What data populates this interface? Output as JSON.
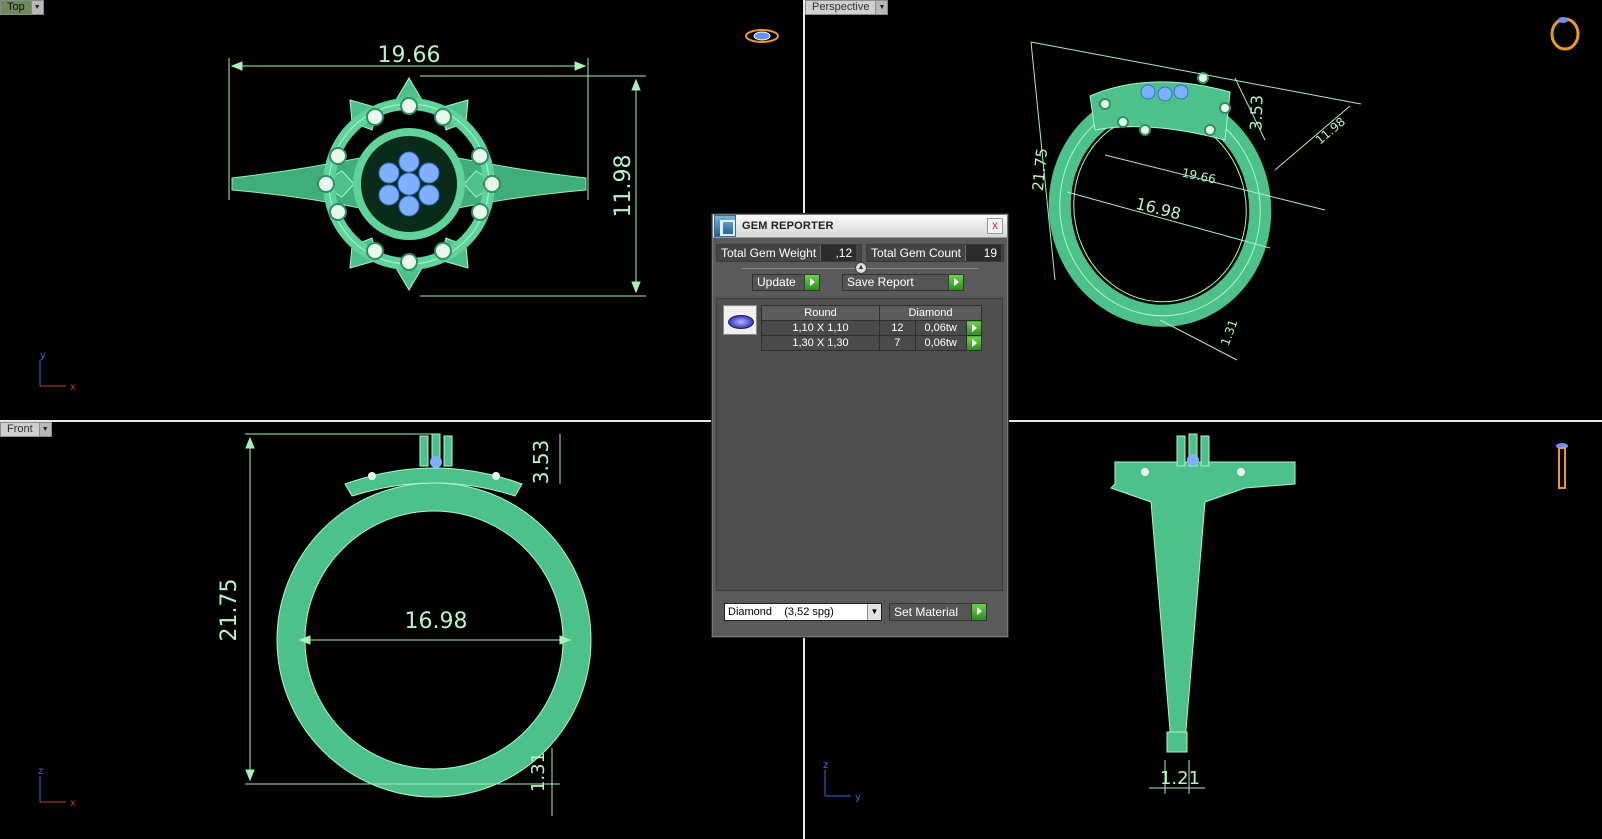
{
  "viewports": {
    "top": {
      "label": "Top",
      "dims": {
        "width": "19.66",
        "height": "11.98"
      }
    },
    "perspective": {
      "label": "Perspective",
      "dims": {
        "a": "21.75",
        "b": "3.53",
        "c": "11.98",
        "d": "19.66",
        "e": "16.98",
        "f": "1.31"
      }
    },
    "front": {
      "label": "Front",
      "dims": {
        "height": "21.75",
        "top": "3.53",
        "inner": "16.98",
        "shank": "1.31"
      }
    },
    "right": {
      "dims": {
        "shank": "1.21"
      }
    }
  },
  "axes": {
    "top": {
      "v": "y",
      "h": "x"
    },
    "front": {
      "v": "z",
      "h": "x"
    },
    "right": {
      "v": "z",
      "h": "y"
    }
  },
  "gem_reporter": {
    "title": "GEM REPORTER",
    "close": "x",
    "total_weight_label": "Total Gem Weight",
    "total_weight_value": ",12",
    "total_count_label": "Total Gem Count",
    "total_count_value": "19",
    "update_label": "Update",
    "save_report_label": "Save Report",
    "columns": [
      "Round",
      "",
      "Diamond"
    ],
    "rows": [
      {
        "size": "1,10 X 1,10",
        "count": "12",
        "weight": "0,06tw"
      },
      {
        "size": "1,30 X 1,30",
        "count": "7",
        "weight": "0,06tw"
      }
    ],
    "material_selected": "Diamond    (3,52 spg)",
    "set_material_label": "Set Material"
  },
  "colors": {
    "ring": "#5fcf96",
    "ring_dark": "#2f8f5f",
    "dimension": "#a8f0b8",
    "gem": "#7fb0ff",
    "accent_go": "#3fae2a"
  }
}
